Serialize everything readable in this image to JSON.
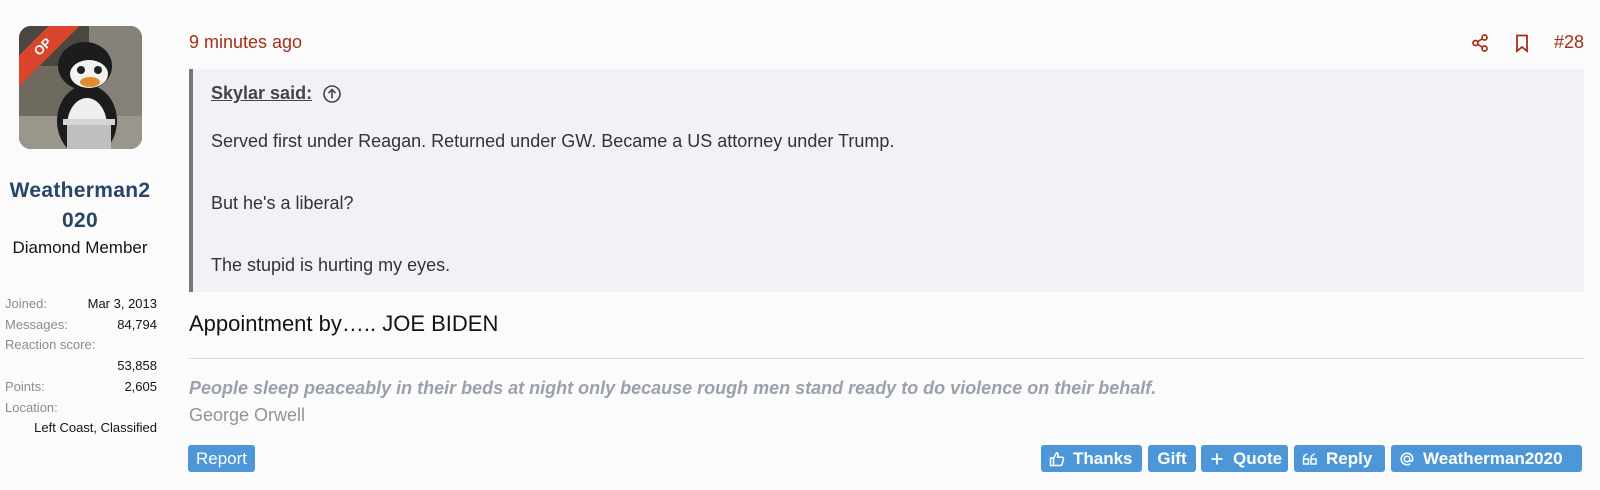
{
  "user": {
    "badge": "OP",
    "username_line1": "Weatherman2",
    "username_line2": "020",
    "title": "Diamond Member",
    "stats": {
      "joined_label": "Joined:",
      "joined_value": "Mar 3, 2013",
      "messages_label": "Messages:",
      "messages_value": "84,794",
      "reaction_label": "Reaction score:",
      "reaction_value": "53,858",
      "points_label": "Points:",
      "points_value": "2,605",
      "location_label": "Location:",
      "location_value": "Left Coast, Classified"
    }
  },
  "post": {
    "time": "9 minutes ago",
    "number": "#28",
    "quote": {
      "author": "Skylar said:",
      "lines": [
        "Served first under Reagan. Returned under GW. Became a US attorney under Trump.",
        "But he's a liberal?",
        "The stupid is hurting my eyes."
      ]
    },
    "body": "Appointment by….. JOE BIDEN",
    "signature": {
      "quote": "People sleep peaceably in their beds at night only because rough men stand ready to do violence on their behalf.",
      "author": "George Orwell"
    }
  },
  "actions": {
    "report": "Report",
    "thanks": "Thanks",
    "gift": "Gift",
    "quote": "Quote",
    "reply": "Reply",
    "mention": "Weatherman2020"
  },
  "colors": {
    "accent": "#a4301a",
    "username": "#274469",
    "button": "#4d97d9",
    "op_badge": "#d9442c"
  },
  "icons": [
    "share-icon",
    "bookmark-icon",
    "arrow-up-circle-icon",
    "thumbs-up-icon",
    "plus-icon",
    "quote-icon",
    "at-icon"
  ]
}
